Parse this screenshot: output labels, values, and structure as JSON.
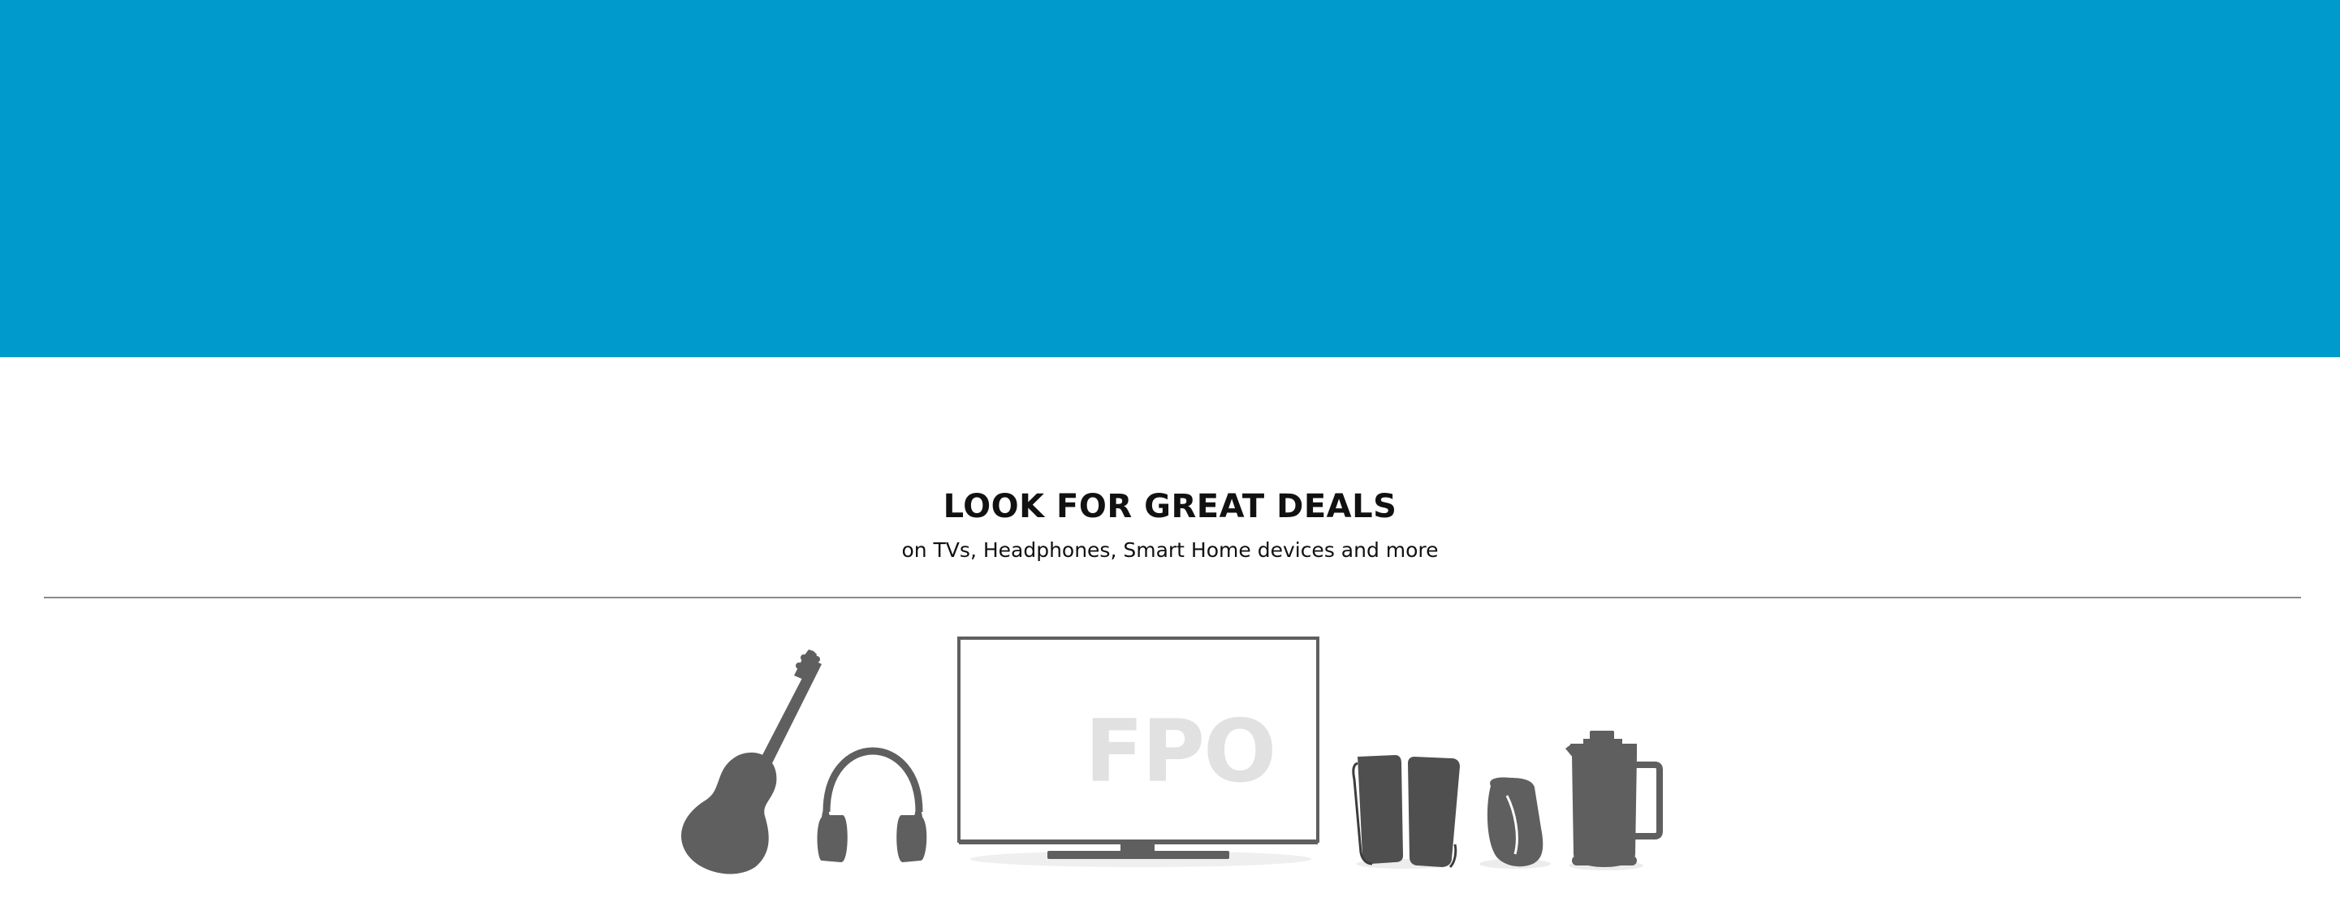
{
  "hero": {
    "background_color": "#009bcc"
  },
  "promo": {
    "headline": "LOOK FOR GREAT DEALS",
    "subline": "on TVs, Headphones, Smart Home devices and more"
  },
  "illustration": {
    "icon_color": "#5f5f5f",
    "tv_screen_text": "FPO",
    "items": [
      {
        "icon": "guitar-icon"
      },
      {
        "icon": "headphones-icon"
      },
      {
        "icon": "tv-icon"
      },
      {
        "icon": "speakers-icon"
      },
      {
        "icon": "fitness-band-icon"
      },
      {
        "icon": "french-press-icon"
      }
    ]
  }
}
